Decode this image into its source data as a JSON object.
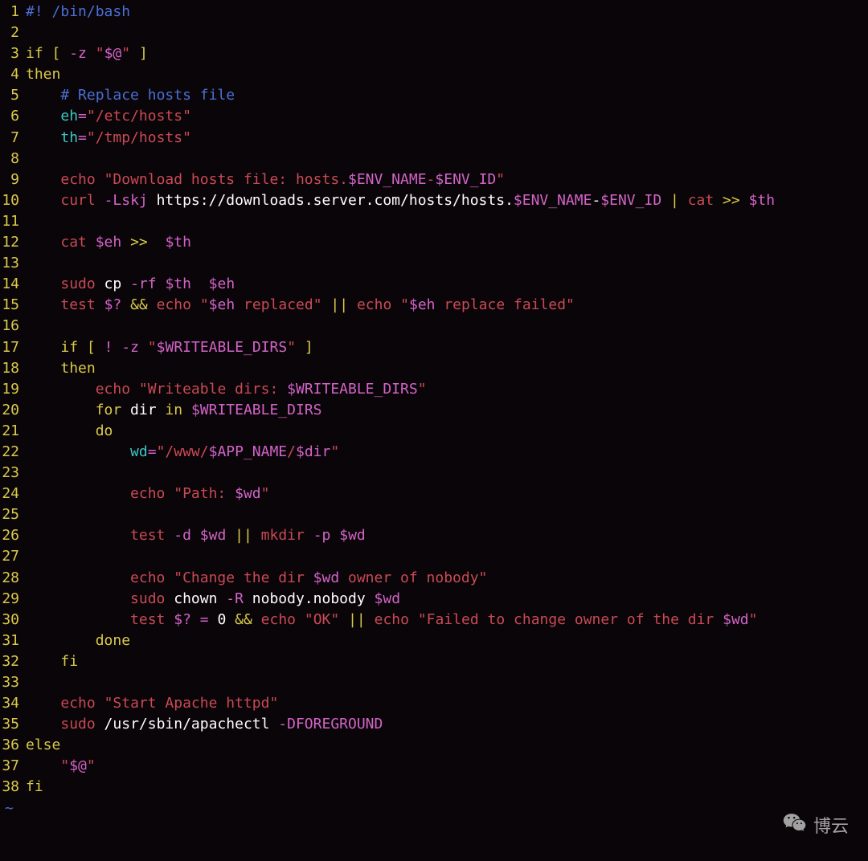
{
  "watermark": {
    "label": "博云"
  },
  "lines": [
    {
      "n": "1",
      "tokens": [
        {
          "cls": "c-comment",
          "t": "#!"
        },
        {
          "cls": "c-white",
          "t": " "
        },
        {
          "cls": "c-comment",
          "t": "/bin/bash"
        }
      ]
    },
    {
      "n": "2",
      "tokens": []
    },
    {
      "n": "3",
      "tokens": [
        {
          "cls": "c-keyword",
          "t": "if"
        },
        {
          "cls": "c-white",
          "t": " "
        },
        {
          "cls": "c-keyword",
          "t": "["
        },
        {
          "cls": "c-white",
          "t": " "
        },
        {
          "cls": "c-pink",
          "t": "-z"
        },
        {
          "cls": "c-white",
          "t": " "
        },
        {
          "cls": "c-string",
          "t": "\""
        },
        {
          "cls": "c-var",
          "t": "$@"
        },
        {
          "cls": "c-string",
          "t": "\""
        },
        {
          "cls": "c-white",
          "t": " "
        },
        {
          "cls": "c-keyword",
          "t": "]"
        }
      ]
    },
    {
      "n": "4",
      "tokens": [
        {
          "cls": "c-keyword",
          "t": "then"
        }
      ]
    },
    {
      "n": "5",
      "tokens": [
        {
          "cls": "c-white",
          "t": "    "
        },
        {
          "cls": "c-comment",
          "t": "# Replace hosts file"
        }
      ]
    },
    {
      "n": "6",
      "tokens": [
        {
          "cls": "c-white",
          "t": "    "
        },
        {
          "cls": "c-cyan",
          "t": "eh"
        },
        {
          "cls": "c-pink",
          "t": "="
        },
        {
          "cls": "c-string",
          "t": "\"/etc/hosts\""
        }
      ]
    },
    {
      "n": "7",
      "tokens": [
        {
          "cls": "c-white",
          "t": "    "
        },
        {
          "cls": "c-cyan",
          "t": "th"
        },
        {
          "cls": "c-pink",
          "t": "="
        },
        {
          "cls": "c-string",
          "t": "\"/tmp/hosts\""
        }
      ]
    },
    {
      "n": "8",
      "tokens": []
    },
    {
      "n": "9",
      "tokens": [
        {
          "cls": "c-white",
          "t": "    "
        },
        {
          "cls": "c-cmd",
          "t": "echo"
        },
        {
          "cls": "c-white",
          "t": " "
        },
        {
          "cls": "c-string",
          "t": "\"Download hosts file: hosts."
        },
        {
          "cls": "c-var",
          "t": "$ENV_NAME"
        },
        {
          "cls": "c-string",
          "t": "-"
        },
        {
          "cls": "c-var",
          "t": "$ENV_ID"
        },
        {
          "cls": "c-string",
          "t": "\""
        }
      ]
    },
    {
      "n": "10",
      "tokens": [
        {
          "cls": "c-white",
          "t": "    "
        },
        {
          "cls": "c-cmd",
          "t": "curl"
        },
        {
          "cls": "c-white",
          "t": " "
        },
        {
          "cls": "c-flag",
          "t": "-Lskj"
        },
        {
          "cls": "c-white",
          "t": " https://downloads.server.com/hosts/hosts."
        },
        {
          "cls": "c-var",
          "t": "$ENV_NAME"
        },
        {
          "cls": "c-white",
          "t": "-"
        },
        {
          "cls": "c-var",
          "t": "$ENV_ID"
        },
        {
          "cls": "c-white",
          "t": " "
        },
        {
          "cls": "c-keyword",
          "t": "|"
        },
        {
          "cls": "c-white",
          "t": " "
        },
        {
          "cls": "c-cmd",
          "t": "cat"
        },
        {
          "cls": "c-white",
          "t": " "
        },
        {
          "cls": "c-keyword",
          "t": ">>"
        },
        {
          "cls": "c-white",
          "t": " "
        },
        {
          "cls": "c-var",
          "t": "$th"
        }
      ]
    },
    {
      "n": "11",
      "tokens": []
    },
    {
      "n": "12",
      "tokens": [
        {
          "cls": "c-white",
          "t": "    "
        },
        {
          "cls": "c-cmd",
          "t": "cat"
        },
        {
          "cls": "c-white",
          "t": " "
        },
        {
          "cls": "c-var",
          "t": "$eh"
        },
        {
          "cls": "c-white",
          "t": " "
        },
        {
          "cls": "c-keyword",
          "t": ">>"
        },
        {
          "cls": "c-white",
          "t": "  "
        },
        {
          "cls": "c-var",
          "t": "$th"
        }
      ]
    },
    {
      "n": "13",
      "tokens": []
    },
    {
      "n": "14",
      "tokens": [
        {
          "cls": "c-white",
          "t": "    "
        },
        {
          "cls": "c-cmd",
          "t": "sudo"
        },
        {
          "cls": "c-white",
          "t": " cp "
        },
        {
          "cls": "c-flag",
          "t": "-rf"
        },
        {
          "cls": "c-white",
          "t": " "
        },
        {
          "cls": "c-var",
          "t": "$th"
        },
        {
          "cls": "c-white",
          "t": "  "
        },
        {
          "cls": "c-var",
          "t": "$eh"
        }
      ]
    },
    {
      "n": "15",
      "tokens": [
        {
          "cls": "c-white",
          "t": "    "
        },
        {
          "cls": "c-cmd",
          "t": "test"
        },
        {
          "cls": "c-white",
          "t": " "
        },
        {
          "cls": "c-var",
          "t": "$?"
        },
        {
          "cls": "c-white",
          "t": " "
        },
        {
          "cls": "c-oper",
          "t": "&&"
        },
        {
          "cls": "c-white",
          "t": " "
        },
        {
          "cls": "c-cmd",
          "t": "echo"
        },
        {
          "cls": "c-white",
          "t": " "
        },
        {
          "cls": "c-string",
          "t": "\""
        },
        {
          "cls": "c-var",
          "t": "$eh"
        },
        {
          "cls": "c-string",
          "t": " replaced\""
        },
        {
          "cls": "c-white",
          "t": " "
        },
        {
          "cls": "c-oper",
          "t": "||"
        },
        {
          "cls": "c-white",
          "t": " "
        },
        {
          "cls": "c-cmd",
          "t": "echo"
        },
        {
          "cls": "c-white",
          "t": " "
        },
        {
          "cls": "c-string",
          "t": "\""
        },
        {
          "cls": "c-var",
          "t": "$eh"
        },
        {
          "cls": "c-string",
          "t": " replace failed\""
        }
      ]
    },
    {
      "n": "16",
      "tokens": []
    },
    {
      "n": "17",
      "tokens": [
        {
          "cls": "c-white",
          "t": "    "
        },
        {
          "cls": "c-keyword",
          "t": "if"
        },
        {
          "cls": "c-white",
          "t": " "
        },
        {
          "cls": "c-keyword",
          "t": "["
        },
        {
          "cls": "c-white",
          "t": " "
        },
        {
          "cls": "c-pink",
          "t": "!"
        },
        {
          "cls": "c-white",
          "t": " "
        },
        {
          "cls": "c-pink",
          "t": "-z"
        },
        {
          "cls": "c-white",
          "t": " "
        },
        {
          "cls": "c-string",
          "t": "\""
        },
        {
          "cls": "c-var",
          "t": "$WRITEABLE_DIRS"
        },
        {
          "cls": "c-string",
          "t": "\""
        },
        {
          "cls": "c-white",
          "t": " "
        },
        {
          "cls": "c-keyword",
          "t": "]"
        }
      ]
    },
    {
      "n": "18",
      "tokens": [
        {
          "cls": "c-white",
          "t": "    "
        },
        {
          "cls": "c-keyword",
          "t": "then"
        }
      ]
    },
    {
      "n": "19",
      "tokens": [
        {
          "cls": "c-white",
          "t": "        "
        },
        {
          "cls": "c-cmd",
          "t": "echo"
        },
        {
          "cls": "c-white",
          "t": " "
        },
        {
          "cls": "c-string",
          "t": "\"Writeable dirs: "
        },
        {
          "cls": "c-var",
          "t": "$WRITEABLE_DIRS"
        },
        {
          "cls": "c-string",
          "t": "\""
        }
      ]
    },
    {
      "n": "20",
      "tokens": [
        {
          "cls": "c-white",
          "t": "        "
        },
        {
          "cls": "c-keyword",
          "t": "for"
        },
        {
          "cls": "c-white",
          "t": " dir "
        },
        {
          "cls": "c-keyword",
          "t": "in"
        },
        {
          "cls": "c-white",
          "t": " "
        },
        {
          "cls": "c-var",
          "t": "$WRITEABLE_DIRS"
        }
      ]
    },
    {
      "n": "21",
      "tokens": [
        {
          "cls": "c-white",
          "t": "        "
        },
        {
          "cls": "c-keyword",
          "t": "do"
        }
      ]
    },
    {
      "n": "22",
      "tokens": [
        {
          "cls": "c-white",
          "t": "            "
        },
        {
          "cls": "c-cyan",
          "t": "wd"
        },
        {
          "cls": "c-pink",
          "t": "="
        },
        {
          "cls": "c-string",
          "t": "\"/www/"
        },
        {
          "cls": "c-var",
          "t": "$APP_NAME"
        },
        {
          "cls": "c-string",
          "t": "/"
        },
        {
          "cls": "c-var",
          "t": "$dir"
        },
        {
          "cls": "c-string",
          "t": "\""
        }
      ]
    },
    {
      "n": "23",
      "tokens": []
    },
    {
      "n": "24",
      "tokens": [
        {
          "cls": "c-white",
          "t": "            "
        },
        {
          "cls": "c-cmd",
          "t": "echo"
        },
        {
          "cls": "c-white",
          "t": " "
        },
        {
          "cls": "c-string",
          "t": "\"Path: "
        },
        {
          "cls": "c-var",
          "t": "$wd"
        },
        {
          "cls": "c-string",
          "t": "\""
        }
      ]
    },
    {
      "n": "25",
      "tokens": []
    },
    {
      "n": "26",
      "tokens": [
        {
          "cls": "c-white",
          "t": "            "
        },
        {
          "cls": "c-cmd",
          "t": "test"
        },
        {
          "cls": "c-white",
          "t": " "
        },
        {
          "cls": "c-flag",
          "t": "-d"
        },
        {
          "cls": "c-white",
          "t": " "
        },
        {
          "cls": "c-var",
          "t": "$wd"
        },
        {
          "cls": "c-white",
          "t": " "
        },
        {
          "cls": "c-oper",
          "t": "||"
        },
        {
          "cls": "c-white",
          "t": " "
        },
        {
          "cls": "c-cmd",
          "t": "mkdir"
        },
        {
          "cls": "c-white",
          "t": " "
        },
        {
          "cls": "c-flag",
          "t": "-p"
        },
        {
          "cls": "c-white",
          "t": " "
        },
        {
          "cls": "c-var",
          "t": "$wd"
        }
      ]
    },
    {
      "n": "27",
      "tokens": []
    },
    {
      "n": "28",
      "tokens": [
        {
          "cls": "c-white",
          "t": "            "
        },
        {
          "cls": "c-cmd",
          "t": "echo"
        },
        {
          "cls": "c-white",
          "t": " "
        },
        {
          "cls": "c-string",
          "t": "\"Change the dir "
        },
        {
          "cls": "c-var",
          "t": "$wd"
        },
        {
          "cls": "c-string",
          "t": " owner of nobody\""
        }
      ]
    },
    {
      "n": "29",
      "tokens": [
        {
          "cls": "c-white",
          "t": "            "
        },
        {
          "cls": "c-cmd",
          "t": "sudo"
        },
        {
          "cls": "c-white",
          "t": " chown "
        },
        {
          "cls": "c-flag",
          "t": "-R"
        },
        {
          "cls": "c-white",
          "t": " nobody.nobody "
        },
        {
          "cls": "c-var",
          "t": "$wd"
        }
      ]
    },
    {
      "n": "30",
      "tokens": [
        {
          "cls": "c-white",
          "t": "            "
        },
        {
          "cls": "c-cmd",
          "t": "test"
        },
        {
          "cls": "c-white",
          "t": " "
        },
        {
          "cls": "c-var",
          "t": "$?"
        },
        {
          "cls": "c-white",
          "t": " "
        },
        {
          "cls": "c-pink",
          "t": "="
        },
        {
          "cls": "c-white",
          "t": " 0 "
        },
        {
          "cls": "c-oper",
          "t": "&&"
        },
        {
          "cls": "c-white",
          "t": " "
        },
        {
          "cls": "c-cmd",
          "t": "echo"
        },
        {
          "cls": "c-white",
          "t": " "
        },
        {
          "cls": "c-string",
          "t": "\"OK\""
        },
        {
          "cls": "c-white",
          "t": " "
        },
        {
          "cls": "c-oper",
          "t": "||"
        },
        {
          "cls": "c-white",
          "t": " "
        },
        {
          "cls": "c-cmd",
          "t": "echo"
        },
        {
          "cls": "c-white",
          "t": " "
        },
        {
          "cls": "c-string",
          "t": "\"Failed to change owner of the dir "
        },
        {
          "cls": "c-var",
          "t": "$wd"
        },
        {
          "cls": "c-string",
          "t": "\""
        }
      ]
    },
    {
      "n": "31",
      "tokens": [
        {
          "cls": "c-white",
          "t": "        "
        },
        {
          "cls": "c-keyword",
          "t": "done"
        }
      ]
    },
    {
      "n": "32",
      "tokens": [
        {
          "cls": "c-white",
          "t": "    "
        },
        {
          "cls": "c-keyword",
          "t": "fi"
        }
      ]
    },
    {
      "n": "33",
      "tokens": []
    },
    {
      "n": "34",
      "tokens": [
        {
          "cls": "c-white",
          "t": "    "
        },
        {
          "cls": "c-cmd",
          "t": "echo"
        },
        {
          "cls": "c-white",
          "t": " "
        },
        {
          "cls": "c-string",
          "t": "\"Start Apache httpd\""
        }
      ]
    },
    {
      "n": "35",
      "tokens": [
        {
          "cls": "c-white",
          "t": "    "
        },
        {
          "cls": "c-cmd",
          "t": "sudo"
        },
        {
          "cls": "c-white",
          "t": " /usr/sbin/apachectl "
        },
        {
          "cls": "c-flag",
          "t": "-DFOREGROUND"
        }
      ]
    },
    {
      "n": "36",
      "tokens": [
        {
          "cls": "c-keyword",
          "t": "else"
        }
      ]
    },
    {
      "n": "37",
      "tokens": [
        {
          "cls": "c-white",
          "t": "    "
        },
        {
          "cls": "c-string",
          "t": "\""
        },
        {
          "cls": "c-var",
          "t": "$@"
        },
        {
          "cls": "c-string",
          "t": "\""
        }
      ]
    },
    {
      "n": "38",
      "tokens": [
        {
          "cls": "c-keyword",
          "t": "fi"
        }
      ]
    }
  ],
  "tilde": "~"
}
